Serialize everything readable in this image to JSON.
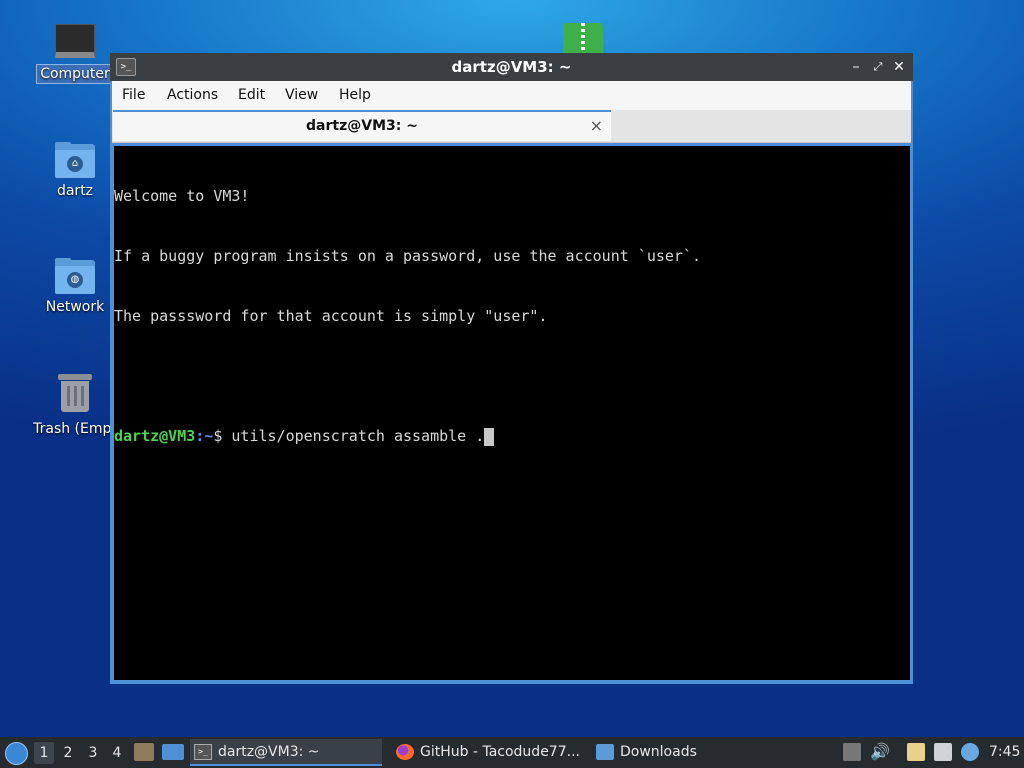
{
  "desktop": {
    "icons": [
      {
        "label": "Computer",
        "icon": "computer-icon"
      },
      {
        "label": "dartz",
        "icon": "home-folder-icon"
      },
      {
        "label": "Network",
        "icon": "network-folder-icon"
      },
      {
        "label": "Trash (Empt",
        "icon": "trash-icon"
      }
    ]
  },
  "window": {
    "title": "dartz@VM3: ~",
    "menu": [
      "File",
      "Actions",
      "Edit",
      "View",
      "Help"
    ],
    "tab_label": "dartz@VM3: ~",
    "tab_close": "×"
  },
  "terminal": {
    "lines": [
      "Welcome to VM3!",
      "If a buggy program insists on a password, use the account `user`.",
      "The passsword for that account is simply \"user\"."
    ],
    "prompt_user": "dartz@VM3",
    "prompt_path": ":~",
    "prompt_symbol": "$ ",
    "command": "utils/openscratch assamble ."
  },
  "taskbar": {
    "workspaces": [
      "1",
      "2",
      "3",
      "4"
    ],
    "tasks": [
      {
        "label": "dartz@VM3: ~",
        "icon": "terminal-icon"
      },
      {
        "label": "GitHub - Tacodude77...",
        "icon": "firefox-icon"
      },
      {
        "label": "Downloads",
        "icon": "folder-icon"
      }
    ],
    "clock": "7:45"
  },
  "colors": {
    "prompt_user": "#4ed34e",
    "prompt_path": "#5a8ee6",
    "titlebar": "#3c3f41",
    "taskbar": "#262b30"
  }
}
